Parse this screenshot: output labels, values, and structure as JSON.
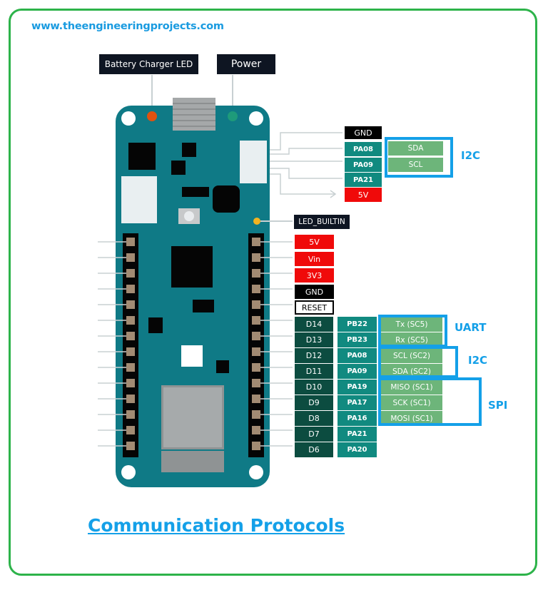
{
  "website": "www.theengineeringprojects.com",
  "top_labels": {
    "battery_led": "Battery Charger LED",
    "power": "Power",
    "led_builtin": "LED_BUILTIN"
  },
  "header_pins": [
    {
      "label": "GND",
      "color": "black"
    },
    {
      "label": "PA08",
      "color": "teal"
    },
    {
      "label": "PA09",
      "color": "teal"
    },
    {
      "label": "PA21",
      "color": "teal"
    },
    {
      "label": "5V",
      "color": "red"
    }
  ],
  "header_i2c": {
    "label": "I2C",
    "signals": [
      "SDA",
      "SCL"
    ]
  },
  "power_pins": [
    {
      "label": "5V",
      "color": "red"
    },
    {
      "label": "Vin",
      "color": "red"
    },
    {
      "label": "3V3",
      "color": "red"
    },
    {
      "label": "GND",
      "color": "black"
    },
    {
      "label": "RESET",
      "color": "white"
    }
  ],
  "digital_pins": [
    {
      "digital": "D14",
      "port": "PB22",
      "function": "Tx (SC5)"
    },
    {
      "digital": "D13",
      "port": "PB23",
      "function": "Rx (SC5)"
    },
    {
      "digital": "D12",
      "port": "PA08",
      "function": "SCL (SC2)"
    },
    {
      "digital": "D11",
      "port": "PA09",
      "function": "SDA (SC2)"
    },
    {
      "digital": "D10",
      "port": "PA19",
      "function": "MISO (SC1)"
    },
    {
      "digital": "D9",
      "port": "PA17",
      "function": "SCK (SC1)"
    },
    {
      "digital": "D8",
      "port": "PA16",
      "function": "MOSI (SC1)"
    },
    {
      "digital": "D7",
      "port": "PA21",
      "function": ""
    },
    {
      "digital": "D6",
      "port": "PA20",
      "function": ""
    }
  ],
  "protocol_groups": {
    "uart": "UART",
    "i2c": "I2C",
    "spi": "SPI"
  },
  "caption": "Communication Protocols",
  "colors": {
    "frame": "#2db34a",
    "accent_blue": "#14a0e8",
    "board": "#0f7a86",
    "red_pin": "#f00a0a",
    "teal_pin": "#118a80",
    "dark_pin": "#0c4c40",
    "green_pin": "#6db57a"
  }
}
